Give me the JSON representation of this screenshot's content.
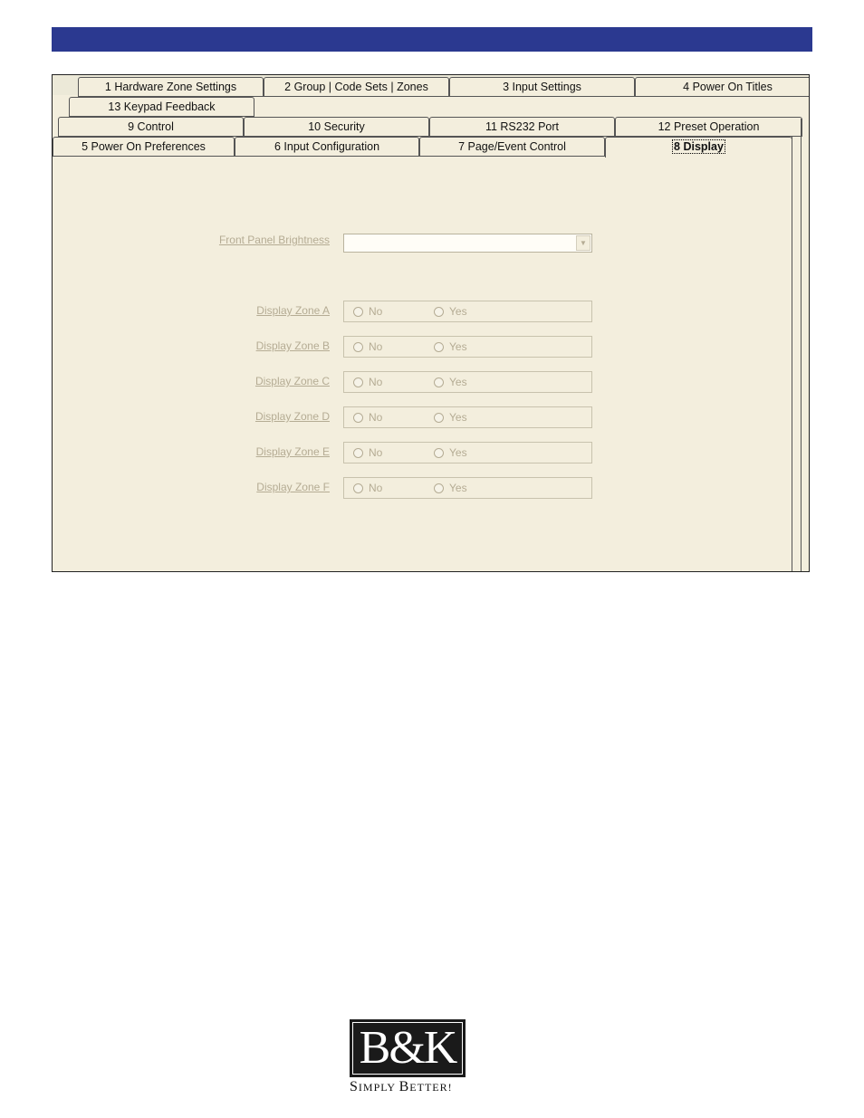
{
  "tabs": {
    "row1": [
      {
        "label": "1   Hardware Zone Settings"
      },
      {
        "label": "2  Group | Code Sets | Zones"
      },
      {
        "label": "3   Input Settings"
      },
      {
        "label": "4   Power On Titles"
      }
    ],
    "row1b": [
      {
        "label": "13 Keypad Feedback"
      }
    ],
    "row2": [
      {
        "label": "9   Control"
      },
      {
        "label": "10   Security"
      },
      {
        "label": "11   RS232 Port"
      },
      {
        "label": "12   Preset Operation"
      }
    ],
    "row3": [
      {
        "label": "5   Power On Preferences"
      },
      {
        "label": "6   Input Configuration"
      },
      {
        "label": "7   Page/Event Control"
      },
      {
        "label": "8    Display"
      }
    ]
  },
  "form": {
    "brightness_label": "Front Panel Brightness",
    "brightness_value": "",
    "zones": [
      {
        "label": "Display Zone A",
        "no": "No",
        "yes": "Yes"
      },
      {
        "label": "Display Zone B",
        "no": "No",
        "yes": "Yes"
      },
      {
        "label": "Display Zone C",
        "no": "No",
        "yes": "Yes"
      },
      {
        "label": "Display Zone D",
        "no": "No",
        "yes": "Yes"
      },
      {
        "label": "Display Zone E",
        "no": "No",
        "yes": "Yes"
      },
      {
        "label": "Display Zone F",
        "no": "No",
        "yes": "Yes"
      }
    ]
  },
  "footer": {
    "logo_text": "B&K",
    "tagline_s": "S",
    "tagline_imply": "IMPLY",
    "tagline_b": "B",
    "tagline_etter": "ETTER!"
  },
  "colors": {
    "header_bar": "#2b3990",
    "panel_bg": "#f3eedd",
    "disabled_text": "#b5ac94"
  }
}
